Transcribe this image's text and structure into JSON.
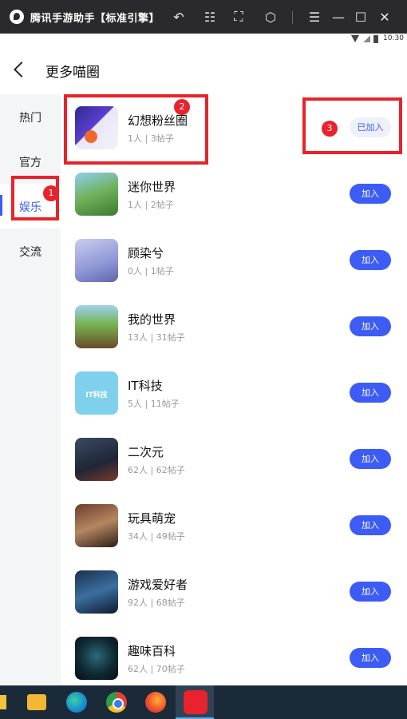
{
  "titlebar": {
    "title": "腾讯手游助手【标准引擎】",
    "icons": [
      "app-logo-icon",
      "undo-icon",
      "grid-icon",
      "fullscreen-icon",
      "cube-icon",
      "menu-icon",
      "minimize-icon",
      "maximize-icon",
      "close-icon"
    ]
  },
  "statusbar": {
    "time": "10:30"
  },
  "header": {
    "title": "更多喵圈"
  },
  "sidebar": {
    "items": [
      {
        "label": "热门"
      },
      {
        "label": "官方"
      },
      {
        "label": "娱乐",
        "active": true
      },
      {
        "label": "交流"
      }
    ]
  },
  "circles": [
    {
      "name": "幻想粉丝圈",
      "meta": "1人 | 3帖子",
      "button": "已加入",
      "joined": true
    },
    {
      "name": "迷你世界",
      "meta": "1人 | 2帖子",
      "button": "加入"
    },
    {
      "name": "顾染兮",
      "meta": "0人 | 1帖子",
      "button": "加入"
    },
    {
      "name": "我的世界",
      "meta": "13人 | 31帖子",
      "button": "加入"
    },
    {
      "name": "IT科技",
      "meta": "5人 | 11帖子",
      "button": "加入",
      "thumb_text": "IT科技"
    },
    {
      "name": "二次元",
      "meta": "62人 | 62帖子",
      "button": "加入"
    },
    {
      "name": "玩具萌宠",
      "meta": "34人 | 49帖子",
      "button": "加入"
    },
    {
      "name": "游戏爱好者",
      "meta": "92人 | 68帖子",
      "button": "加入"
    },
    {
      "name": "趣味百科",
      "meta": "62人 | 70帖子",
      "button": "加入"
    }
  ],
  "annotations": {
    "badges": [
      "1",
      "2",
      "3"
    ],
    "color": "#e8232b"
  },
  "colors": {
    "accent": "#3d5cf5",
    "sidebar_bg": "#f4f5f7",
    "titlebar_bg": "#2a2a2e",
    "taskbar_bg": "#1b2a38"
  },
  "taskbar": {
    "icons": [
      "taskbar-yellow-icon",
      "cube-app-icon",
      "edge-icon",
      "chrome-icon",
      "firefox-icon",
      "tencent-assistant-icon"
    ]
  }
}
